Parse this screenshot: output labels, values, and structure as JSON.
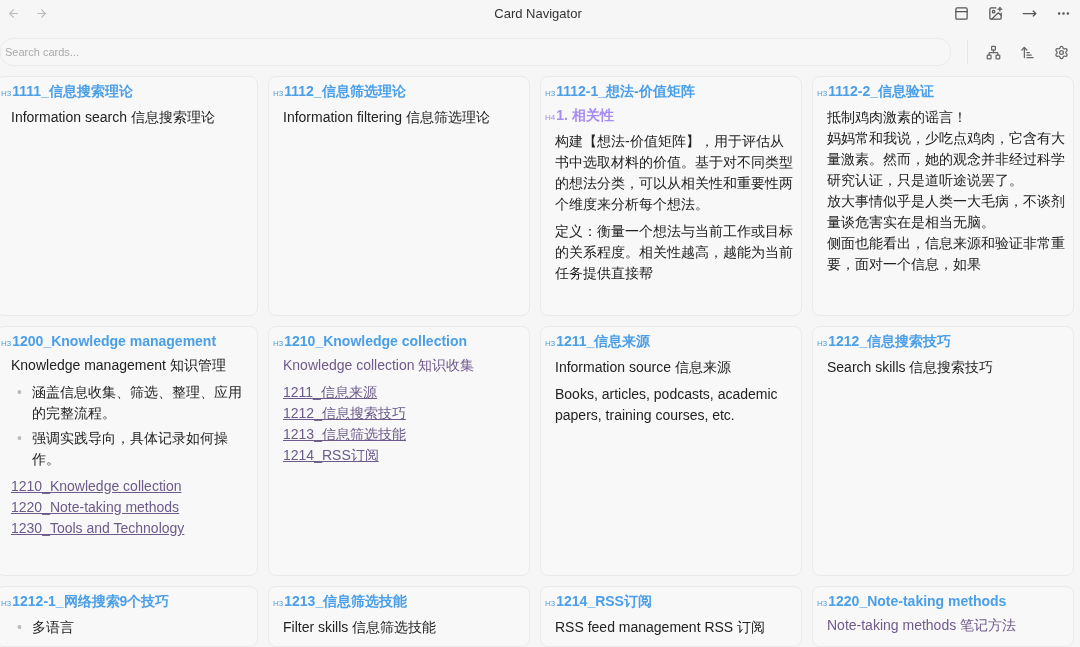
{
  "window": {
    "title": "Card Navigator"
  },
  "search": {
    "placeholder": "Search cards..."
  },
  "cards": [
    {
      "level": "H3",
      "title": "1111_信息搜索理论",
      "blocks": [
        {
          "kind": "paragraph",
          "text": "Information search 信息搜索理论",
          "muted": false
        }
      ]
    },
    {
      "level": "H3",
      "title": "1112_信息筛选理论",
      "blocks": [
        {
          "kind": "paragraph",
          "text": "Information filtering 信息筛选理论",
          "muted": false
        }
      ]
    },
    {
      "level": "H3",
      "title": "1112-1_想法-价值矩阵",
      "blocks": [
        {
          "kind": "subheading",
          "level": "H4",
          "text": "1. 相关性"
        },
        {
          "kind": "paragraph",
          "text": "构建【想法-价值矩阵】，用于评估从书中选取材料的价值。基于对不同类型的想法分类，可以从相关性和重要性两个维度来分析每个想法。",
          "muted": false
        },
        {
          "kind": "paragraph",
          "text": "定义：衡量一个想法与当前工作或目标的关系程度。相关性越高，越能为当前任务提供直接帮",
          "muted": false
        }
      ]
    },
    {
      "level": "H3",
      "title": "1112-2_信息验证",
      "blocks": [
        {
          "kind": "lines",
          "items": [
            "抵制鸡肉激素的谣言！",
            "妈妈常和我说，少吃点鸡肉，它含有大量激素。然而，她的观念并非经过科学研究认证，只是道听途说罢了。",
            "放大事情似乎是人类一大毛病，不谈剂量谈危害实在是相当无脑。",
            "侧面也能看出，信息来源和验证非常重要，面对一个信息，如果"
          ]
        }
      ]
    },
    {
      "level": "H3",
      "title": "1200_Knowledge management",
      "blocks": [
        {
          "kind": "paragraph",
          "text": "Knowledge management 知识管理",
          "muted": false
        },
        {
          "kind": "bullets",
          "marker": "•",
          "items": [
            "涵盖信息收集、筛选、整理、应用的完整流程。",
            "强调实践导向，具体记录如何操作。"
          ]
        },
        {
          "kind": "links",
          "items": [
            "1210_Knowledge collection",
            "1220_Note-taking methods",
            "1230_Tools and Technology"
          ]
        }
      ]
    },
    {
      "level": "H3",
      "title": "1210_Knowledge collection",
      "blocks": [
        {
          "kind": "paragraph",
          "text": "Knowledge collection 知识收集",
          "muted": true
        },
        {
          "kind": "links",
          "items": [
            "1211_信息来源",
            "1212_信息搜索技巧",
            "1213_信息筛选技能",
            "1214_RSS订阅"
          ]
        }
      ]
    },
    {
      "level": "H3",
      "title": "1211_信息来源",
      "blocks": [
        {
          "kind": "paragraph",
          "text": "Information source 信息来源",
          "muted": false
        },
        {
          "kind": "paragraph",
          "text": "Books, articles, podcasts, academic papers, training courses, etc.",
          "muted": false
        }
      ]
    },
    {
      "level": "H3",
      "title": "1212_信息搜索技巧",
      "blocks": [
        {
          "kind": "paragraph",
          "text": "Search skills 信息搜索技巧",
          "muted": false
        }
      ]
    },
    {
      "level": "H3",
      "title": "1212-1_网络搜索9个技巧",
      "blocks": [
        {
          "kind": "bullets",
          "marker": "•",
          "items": [
            "多语言"
          ]
        }
      ]
    },
    {
      "level": "H3",
      "title": "1213_信息筛选技能",
      "blocks": [
        {
          "kind": "paragraph",
          "text": "Filter skills 信息筛选技能",
          "muted": false
        }
      ]
    },
    {
      "level": "H3",
      "title": "1214_RSS订阅",
      "blocks": [
        {
          "kind": "paragraph",
          "text": "RSS feed management RSS 订阅",
          "muted": false
        }
      ]
    },
    {
      "level": "H3",
      "title": "1220_Note-taking methods",
      "blocks": [
        {
          "kind": "paragraph",
          "text": "Note-taking methods 笔记方法",
          "muted": true
        }
      ]
    }
  ]
}
